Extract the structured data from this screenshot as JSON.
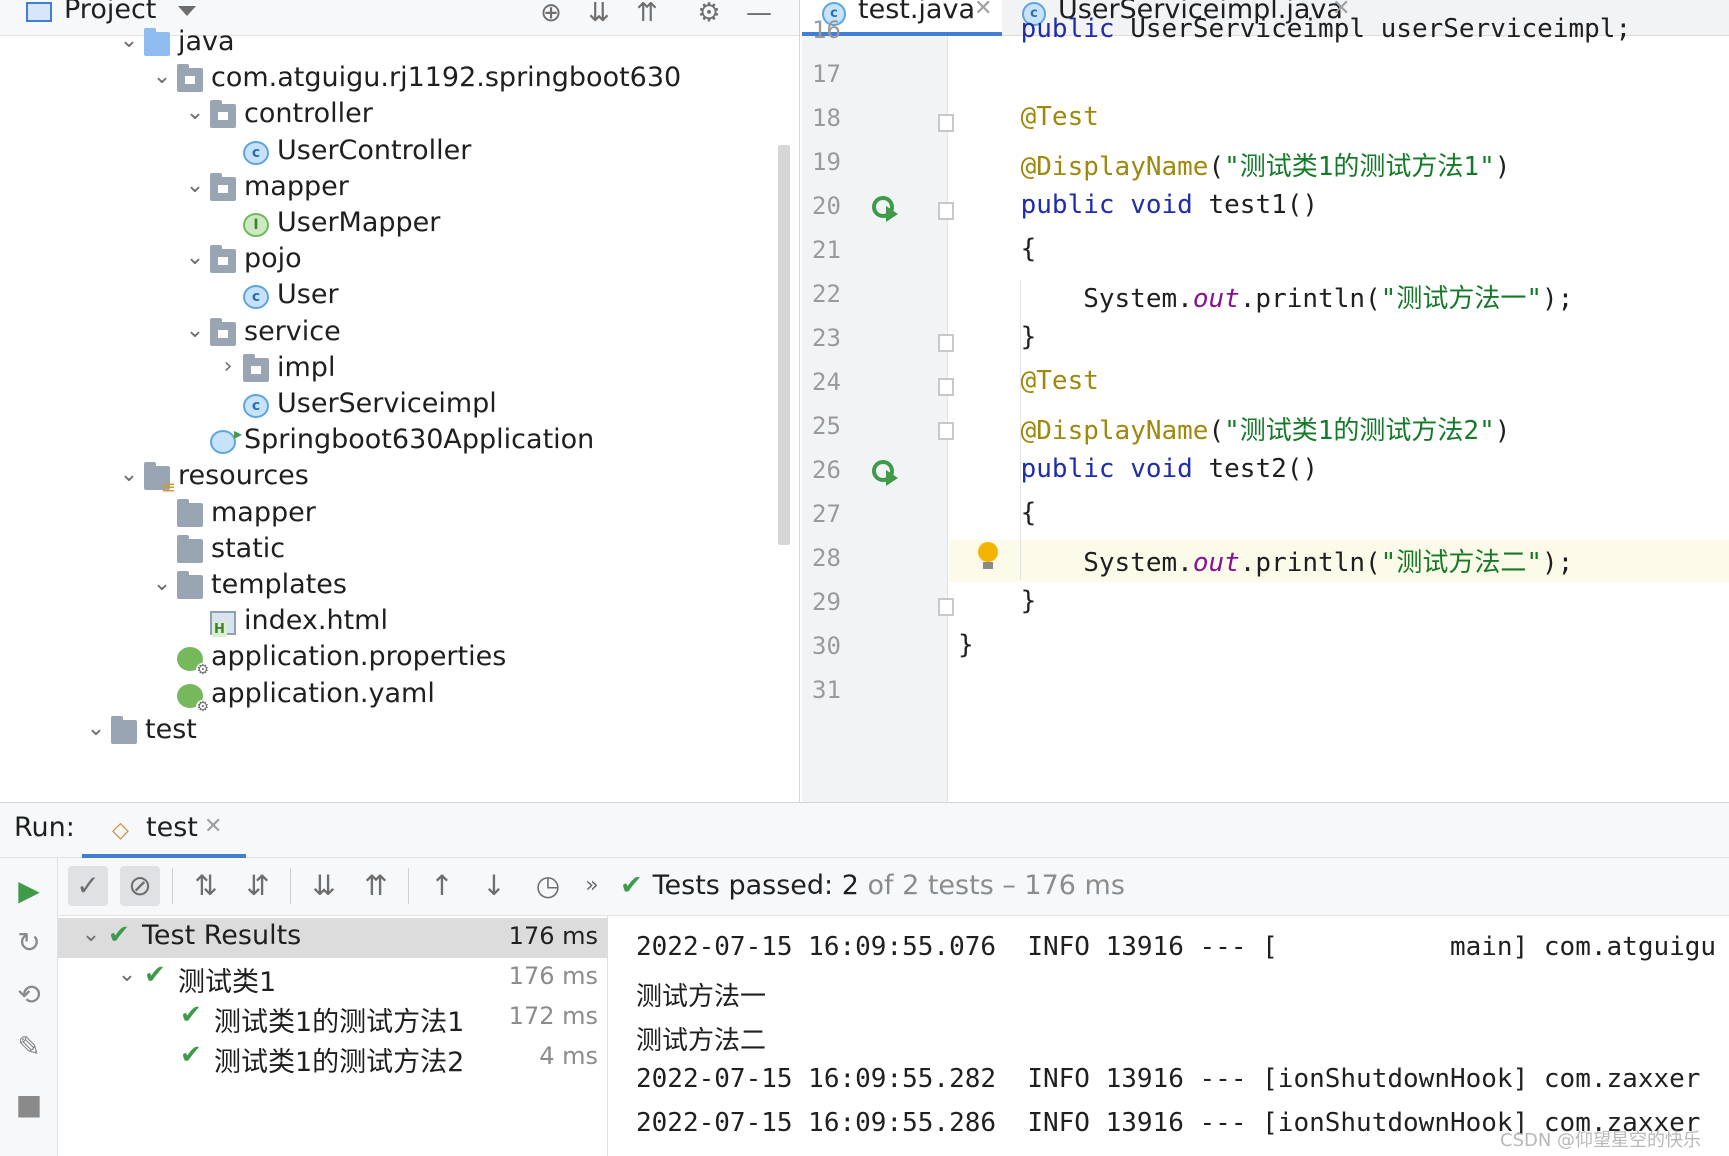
{
  "project": {
    "title": "Project",
    "tree": [
      {
        "label": "java",
        "icon": "source-folder-icon",
        "chev": "⌄",
        "depth": 0
      },
      {
        "label": "com.atguigu.rj1192.springboot630",
        "icon": "package-icon",
        "chev": "⌄",
        "depth": 1
      },
      {
        "label": "controller",
        "icon": "package-icon",
        "chev": "⌄",
        "depth": 2
      },
      {
        "label": "UserController",
        "icon": "class-icon",
        "chev": "",
        "depth": 3
      },
      {
        "label": "mapper",
        "icon": "package-icon",
        "chev": "⌄",
        "depth": 2
      },
      {
        "label": "UserMapper",
        "icon": "interface-icon",
        "chev": "",
        "depth": 3
      },
      {
        "label": "pojo",
        "icon": "package-icon",
        "chev": "⌄",
        "depth": 2
      },
      {
        "label": "User",
        "icon": "class-icon",
        "chev": "",
        "depth": 3
      },
      {
        "label": "service",
        "icon": "package-icon",
        "chev": "⌄",
        "depth": 2
      },
      {
        "label": "impl",
        "icon": "package-icon",
        "chev": "›",
        "depth": 3
      },
      {
        "label": "UserServiceimpl",
        "icon": "class-icon",
        "chev": "",
        "depth": 3
      },
      {
        "label": "Springboot630Application",
        "icon": "spring-app-class-icon",
        "chev": "",
        "depth": 2
      },
      {
        "label": "resources",
        "icon": "resources-folder-icon",
        "chev": "⌄",
        "depth": 0
      },
      {
        "label": "mapper",
        "icon": "folder-icon",
        "chev": "",
        "depth": 1
      },
      {
        "label": "static",
        "icon": "folder-icon",
        "chev": "",
        "depth": 1
      },
      {
        "label": "templates",
        "icon": "folder-icon",
        "chev": "⌄",
        "depth": 1
      },
      {
        "label": "index.html",
        "icon": "html-file-icon",
        "chev": "",
        "depth": 2
      },
      {
        "label": "application.properties",
        "icon": "spring-config-icon",
        "chev": "",
        "depth": 1
      },
      {
        "label": "application.yaml",
        "icon": "spring-config-icon",
        "chev": "",
        "depth": 1
      },
      {
        "label": "test",
        "icon": "folder-icon",
        "chev": "⌄",
        "depth": -1
      }
    ]
  },
  "editor": {
    "tabs": [
      {
        "label": "test.java",
        "active": true
      },
      {
        "label": "UserServiceimpl.java",
        "active": false
      }
    ],
    "lines": [
      {
        "n": "16",
        "text": "    public UserServiceimpl userServiceimpl;"
      },
      {
        "n": "17",
        "text": ""
      },
      {
        "n": "18",
        "text": "    @Test"
      },
      {
        "n": "19",
        "text": "    @DisplayName(\"测试类1的测试方法1\")"
      },
      {
        "n": "20",
        "text": "    public void test1()"
      },
      {
        "n": "21",
        "text": "    {"
      },
      {
        "n": "22",
        "text": "        System.out.println(\"测试方法一\");"
      },
      {
        "n": "23",
        "text": "    }"
      },
      {
        "n": "24",
        "text": "    @Test"
      },
      {
        "n": "25",
        "text": "    @DisplayName(\"测试类1的测试方法2\")"
      },
      {
        "n": "26",
        "text": "    public void test2()"
      },
      {
        "n": "27",
        "text": "    {"
      },
      {
        "n": "28",
        "text": "        System.out.println(\"测试方法二\");"
      },
      {
        "n": "29",
        "text": "    }"
      },
      {
        "n": "30",
        "text": "}"
      },
      {
        "n": "31",
        "text": ""
      }
    ]
  },
  "run": {
    "title": "Run:",
    "tab_label": "test",
    "status_prefix": "Tests passed: ",
    "status_passed": "2",
    "status_suffix": " of 2 tests – 176 ms",
    "results": [
      {
        "label": "Test Results",
        "time": "176 ms",
        "depth": 0,
        "chev": "⌄"
      },
      {
        "label": "测试类1",
        "time": "176 ms",
        "depth": 1,
        "chev": "⌄"
      },
      {
        "label": "测试类1的测试方法1",
        "time": "172 ms",
        "depth": 2,
        "chev": ""
      },
      {
        "label": "测试类1的测试方法2",
        "time": "4 ms",
        "depth": 2,
        "chev": ""
      }
    ],
    "console": [
      "2022-07-15 16:09:55.076  INFO 13916 --- [           main] com.atguigu",
      "测试方法一",
      "测试方法二",
      "2022-07-15 16:09:55.282  INFO 13916 --- [ionShutdownHook] com.zaxxer",
      "2022-07-15 16:09:55.286  INFO 13916 --- [ionShutdownHook] com.zaxxer"
    ]
  },
  "watermark": "CSDN @仰望星空的快乐",
  "colors": {
    "accent": "#3f7fd6",
    "pass_green": "#3f9b4a",
    "keyword": "#1f2dab",
    "annotation": "#9e880d",
    "string": "#157a28"
  }
}
